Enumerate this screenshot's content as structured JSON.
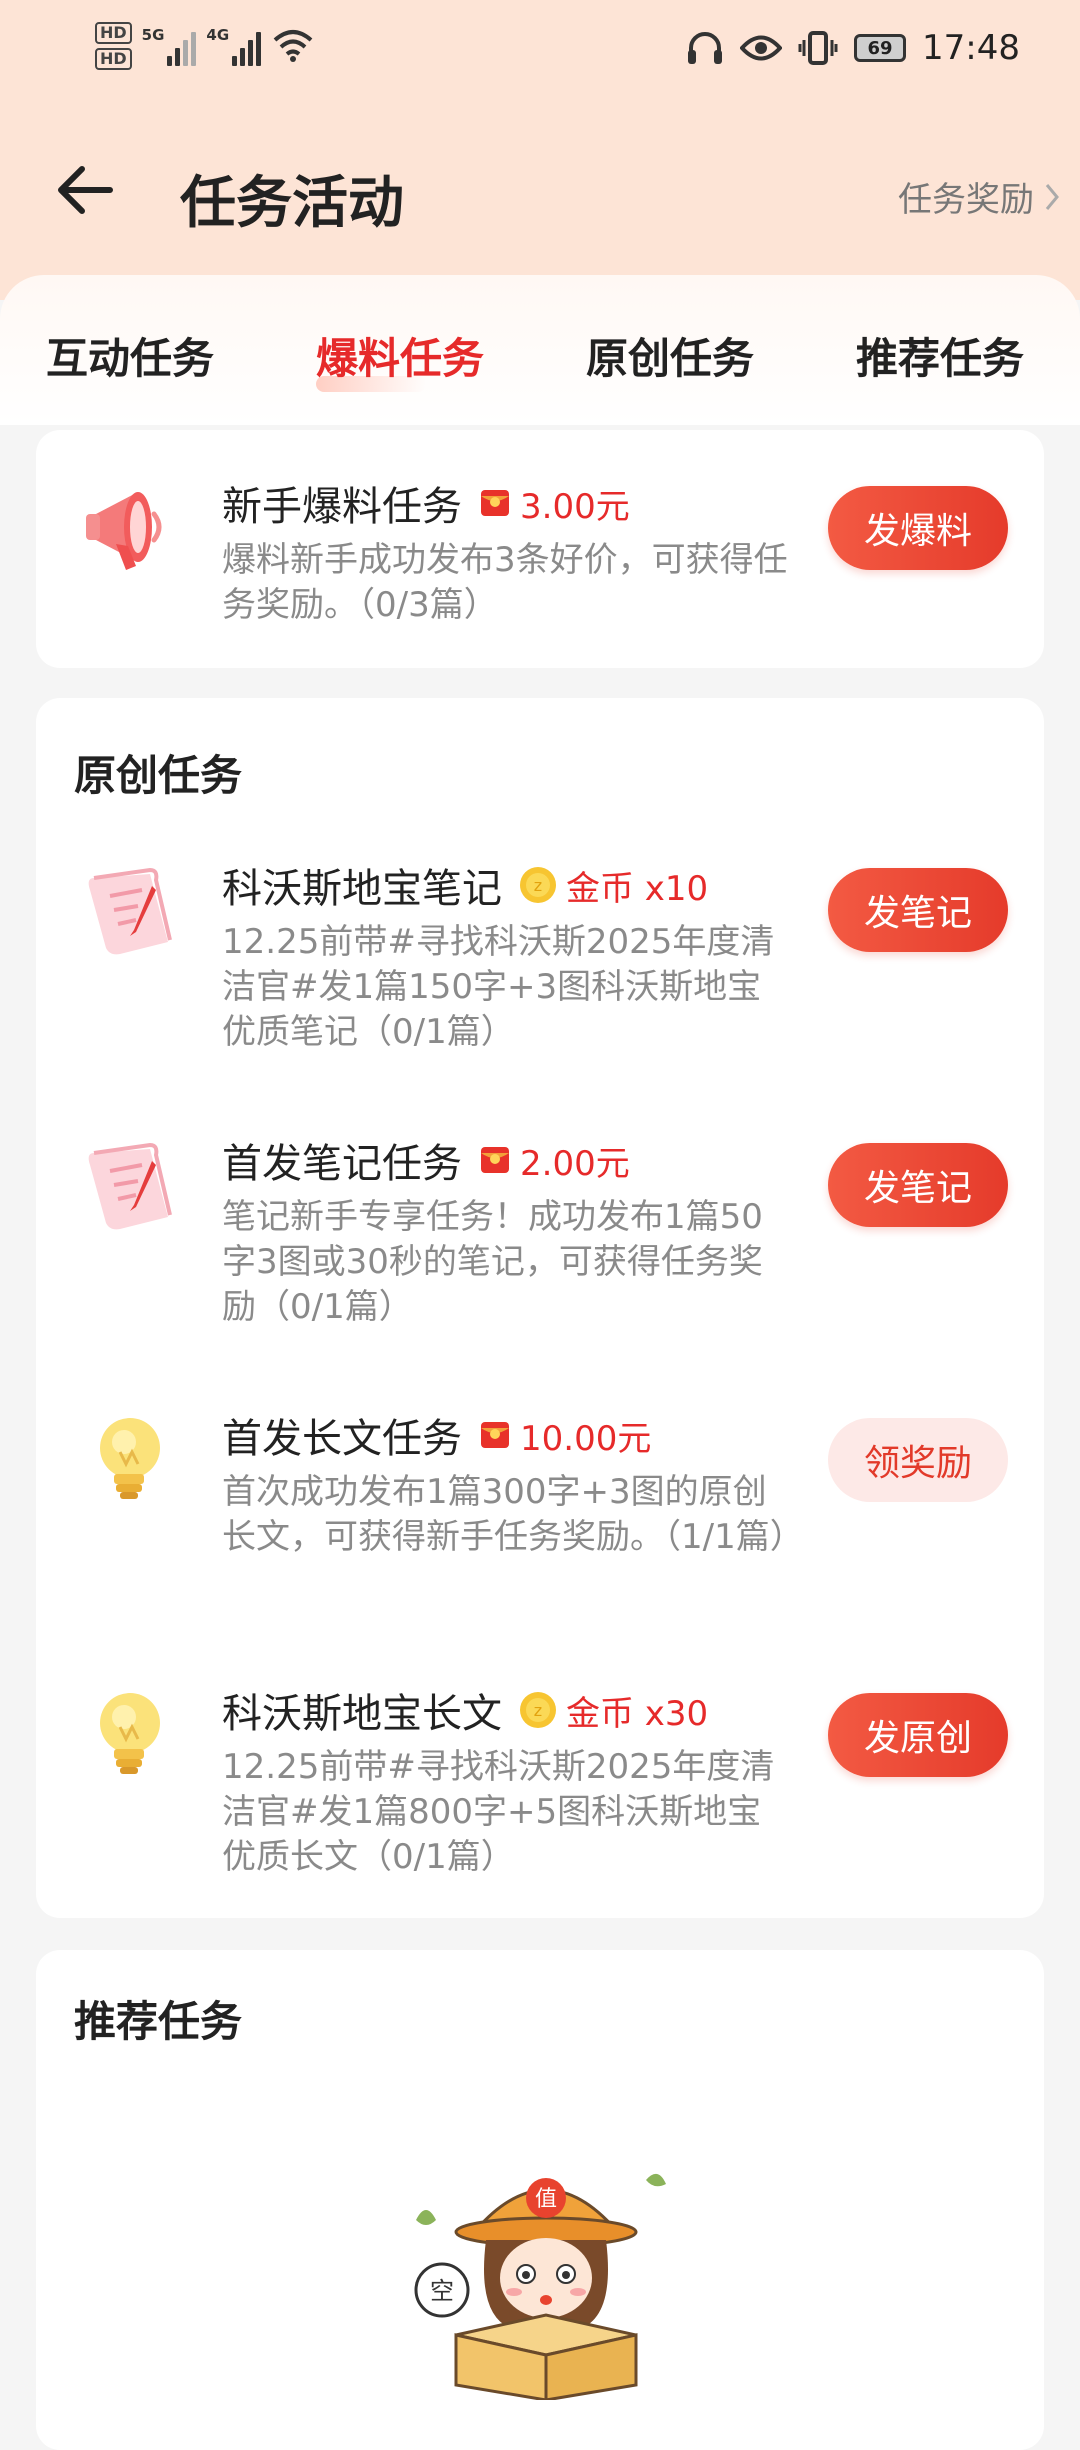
{
  "status_bar": {
    "hd1": "HD",
    "hd2": "HD",
    "net1": "5G",
    "net2": "4G",
    "battery": "69",
    "time": "17:48"
  },
  "header": {
    "title": "任务活动",
    "reward_link": "任务奖励"
  },
  "tabs": [
    {
      "label": "互动任务",
      "active": false
    },
    {
      "label": "爆料任务",
      "active": true
    },
    {
      "label": "原创任务",
      "active": false
    },
    {
      "label": "推荐任务",
      "active": false
    }
  ],
  "leak_section": {
    "tasks": [
      {
        "title": "新手爆料任务",
        "reward": "3.00元",
        "reward_type": "red-packet",
        "desc": "爆料新手成功发布3条好价，可获得任务奖励。（0/3篇）",
        "button": "发爆料",
        "icon": "megaphone-icon"
      }
    ]
  },
  "original_section": {
    "title": "原创任务",
    "tasks": [
      {
        "title": "科沃斯地宝笔记",
        "reward": "金币 x10",
        "reward_type": "coin",
        "desc": "12.25前带#寻找科沃斯2025年度清洁官#发1篇150字+3图科沃斯地宝优质笔记（0/1篇）",
        "button": "发笔记",
        "icon": "note-scroll-icon"
      },
      {
        "title": "首发笔记任务",
        "reward": "2.00元",
        "reward_type": "red-packet",
        "desc": "笔记新手专享任务！成功发布1篇50字3图或30秒的笔记，可获得任务奖励（0/1篇）",
        "button": "发笔记",
        "icon": "note-scroll-icon"
      },
      {
        "title": "首发长文任务",
        "reward": "10.00元",
        "reward_type": "red-packet",
        "desc": "首次成功发布1篇300字+3图的原创长文，可获得新手任务奖励。（1/1篇）",
        "button": "领奖励",
        "icon": "lightbulb-icon"
      },
      {
        "title": "科沃斯地宝长文",
        "reward": "金币 x30",
        "reward_type": "coin",
        "desc": "12.25前带#寻找科沃斯2025年度清洁官#发1篇800字+5图科沃斯地宝优质长文（0/1篇）",
        "button": "发原创",
        "icon": "lightbulb-icon"
      }
    ]
  },
  "recommend_section": {
    "title": "推荐任务",
    "empty_illustration": "empty-box-mascot",
    "hat_char": "值",
    "bubble_char": "空"
  },
  "colors": {
    "accent": "#e62a2a",
    "header_bg": "#fde4d6",
    "button": "#f04a35"
  }
}
